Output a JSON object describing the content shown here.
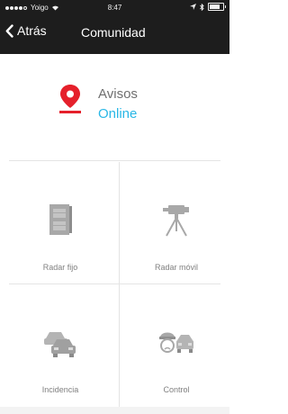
{
  "status": {
    "carrier": "Yoigo",
    "time": "8:47",
    "signal_dots": 5,
    "signal_filled": 4,
    "battery_level": 0.75
  },
  "nav": {
    "back_label": "Atrás",
    "title": "Comunidad"
  },
  "avisos": {
    "label": "Avisos",
    "state": "Online",
    "state_color": "#29b7e6",
    "icon": "map-pin-icon",
    "icon_color": "#e5202b"
  },
  "tiles": [
    {
      "label": "Radar fijo",
      "icon": "fixed-radar-icon"
    },
    {
      "label": "Radar móvil",
      "icon": "mobile-radar-icon"
    },
    {
      "label": "Incidencia",
      "icon": "car-incident-icon"
    },
    {
      "label": "Control",
      "icon": "police-control-icon"
    }
  ],
  "colors": {
    "bar": "#1d1d1d",
    "icon_gray": "#a8a8a8",
    "separator": "#e4e4e4"
  }
}
